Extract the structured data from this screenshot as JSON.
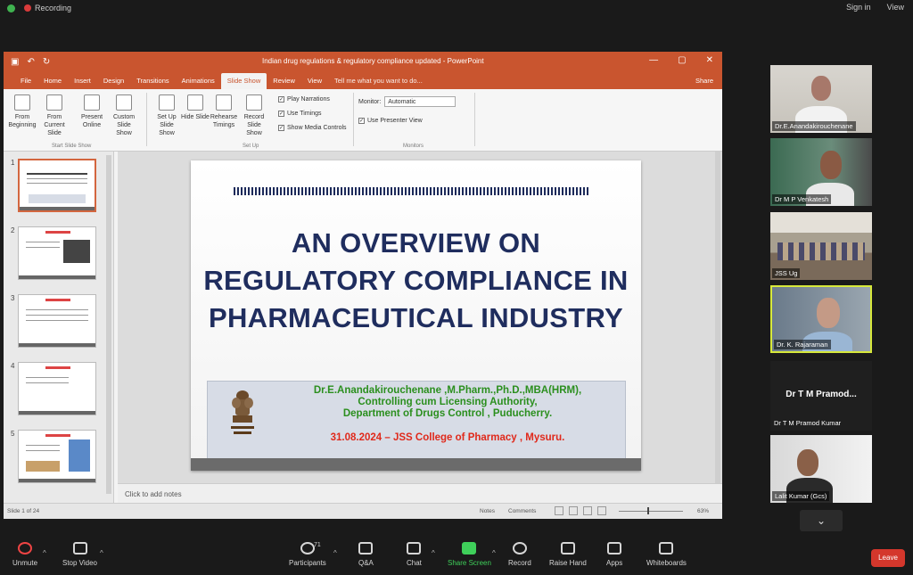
{
  "zoom_bar": {
    "recording_label": "Recording",
    "sign_in": "Sign in",
    "view": "View"
  },
  "powerpoint": {
    "document_title": "Indian drug regulations & regulatory compliance updated - PowerPoint",
    "tabs": [
      "File",
      "Home",
      "Insert",
      "Design",
      "Transitions",
      "Animations",
      "Slide Show",
      "Review",
      "View"
    ],
    "active_tab": "Slide Show",
    "tell_me": "Tell me what you want to do...",
    "share": "Share",
    "ribbon": {
      "from_beginning": "From Beginning",
      "from_current": "From Current Slide",
      "present_online": "Present Online",
      "custom_show": "Custom Slide Show",
      "start_group": "Start Slide Show",
      "setup_show": "Set Up Slide Show",
      "hide_slide": "Hide Slide",
      "rehearse": "Rehearse Timings",
      "record": "Record Slide Show",
      "setup_group": "Set Up",
      "play_narrations": "Play Narrations",
      "use_timings": "Use Timings",
      "show_media": "Show Media Controls",
      "monitor_label": "Monitor:",
      "monitor_value": "Automatic",
      "presenter_view": "Use Presenter View",
      "monitors_group": "Monitors"
    },
    "thumbnail_numbers": [
      "1",
      "2",
      "3",
      "4",
      "5"
    ],
    "slide": {
      "title_line1": "AN OVERVIEW ON",
      "title_line2": "REGULATORY COMPLIANCE IN",
      "title_line3": "PHARMACEUTICAL INDUSTRY",
      "author": "Dr.E.Anandakirouchenane ,M.Pharm.,Ph.D.,MBA(HRM),",
      "role": "Controlling cum Licensing Authority,",
      "department": "Department of Drugs Control , Puducherry.",
      "date_venue": "31.08.2024 – JSS College of Pharmacy , Mysuru."
    },
    "notes_placeholder": "Click to add notes",
    "status": {
      "slide_count": "Slide 1 of 24",
      "notes": "Notes",
      "comments": "Comments",
      "zoom": "63%"
    }
  },
  "participants": [
    "Dr.E.Anandakirouchenane",
    "Dr M P Venkatesh",
    "JSS Ug",
    "Dr. K. Rajaraman",
    "Dr T M Pramod Kumar",
    "Lalit Kumar (Gcs)"
  ],
  "name_only_tile": {
    "big": "Dr T M Pramod...",
    "small": "Dr T M Pramod Kumar"
  },
  "toolbar": {
    "unmute": "Unmute",
    "stop_video": "Stop Video",
    "participants": "Participants",
    "participant_count": "71",
    "qa": "Q&A",
    "chat": "Chat",
    "share_screen": "Share Screen",
    "record": "Record",
    "raise_hand": "Raise Hand",
    "apps": "Apps",
    "whiteboards": "Whiteboards",
    "leave": "Leave"
  }
}
